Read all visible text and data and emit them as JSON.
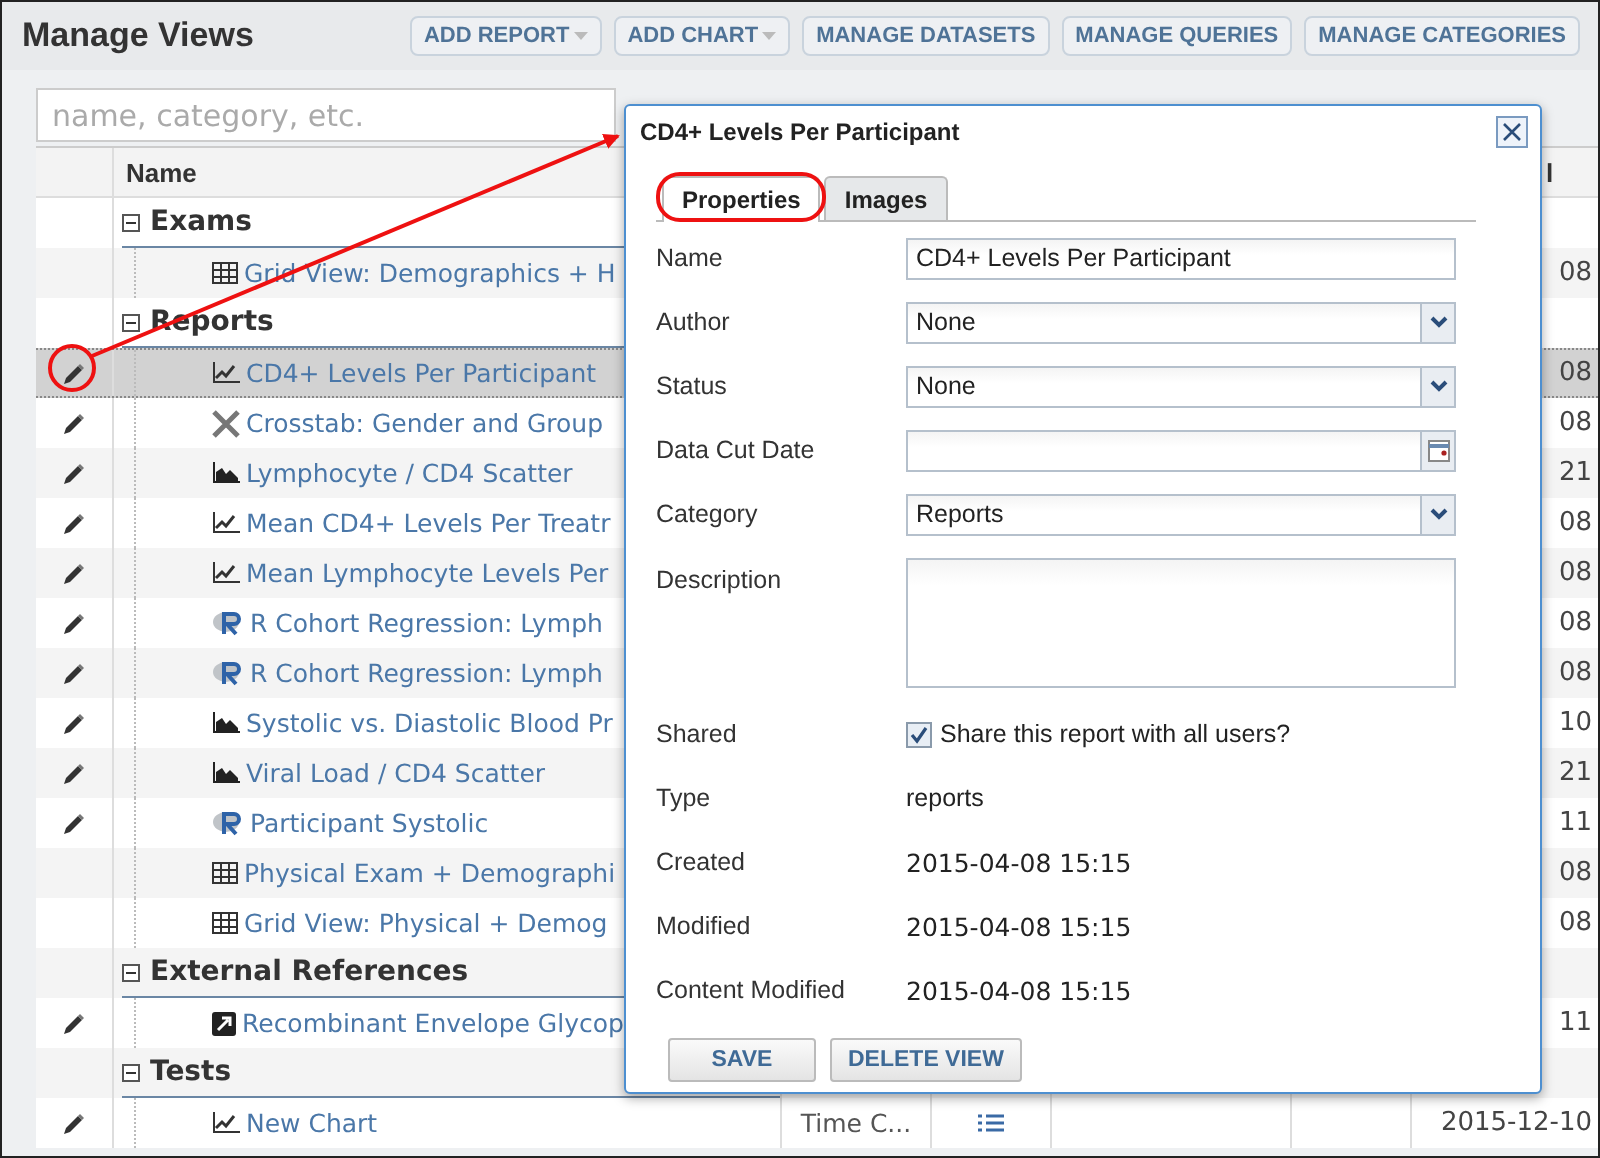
{
  "header": {
    "title": "Manage Views",
    "buttons": [
      {
        "label": "ADD REPORT",
        "dropdown": true
      },
      {
        "label": "ADD CHART",
        "dropdown": true
      },
      {
        "label": "MANAGE DATASETS",
        "dropdown": false
      },
      {
        "label": "MANAGE QUERIES",
        "dropdown": false
      },
      {
        "label": "MANAGE CATEGORIES",
        "dropdown": false
      }
    ]
  },
  "search": {
    "placeholder": "name, category, etc."
  },
  "table": {
    "columns": [
      {
        "label": "Name"
      },
      {
        "label": "l"
      }
    ],
    "groups": [
      {
        "label": "Exams",
        "expanded": true,
        "children": [
          {
            "kind": "grid",
            "name": "Grid View: Demographics + H",
            "editable": false,
            "selected": false,
            "date": "08"
          }
        ]
      },
      {
        "label": "Reports",
        "expanded": true,
        "children": [
          {
            "kind": "line",
            "name": "CD4+ Levels Per Participant",
            "editable": true,
            "selected": true,
            "date": "08"
          },
          {
            "kind": "crosstab",
            "name": "Crosstab: Gender and Group",
            "editable": true,
            "selected": false,
            "date": "08"
          },
          {
            "kind": "scatter",
            "name": "Lymphocyte / CD4 Scatter",
            "editable": true,
            "selected": false,
            "date": "21"
          },
          {
            "kind": "line",
            "name": "Mean CD4+ Levels Per Treatr",
            "editable": true,
            "selected": false,
            "date": "08"
          },
          {
            "kind": "line",
            "name": "Mean Lymphocyte Levels Per",
            "editable": true,
            "selected": false,
            "date": "08"
          },
          {
            "kind": "r",
            "name": "R Cohort Regression: Lymph",
            "editable": true,
            "selected": false,
            "date": "08"
          },
          {
            "kind": "r",
            "name": "R Cohort Regression: Lymph",
            "editable": true,
            "selected": false,
            "date": "08"
          },
          {
            "kind": "scatter",
            "name": "Systolic vs. Diastolic Blood Pr",
            "editable": true,
            "selected": false,
            "date": "10"
          },
          {
            "kind": "scatter",
            "name": "Viral Load / CD4 Scatter",
            "editable": true,
            "selected": false,
            "date": "21"
          },
          {
            "kind": "r",
            "name": "Participant Systolic",
            "editable": true,
            "selected": false,
            "date": "11"
          },
          {
            "kind": "grid",
            "name": "Physical Exam + Demographi",
            "editable": false,
            "selected": false,
            "date": "08"
          },
          {
            "kind": "grid",
            "name": "Grid View: Physical + Demog",
            "editable": false,
            "selected": false,
            "date": "08"
          }
        ]
      },
      {
        "label": "External References",
        "expanded": true,
        "children": [
          {
            "kind": "external",
            "name": "Recombinant Envelope Glycop",
            "editable": true,
            "selected": false,
            "date": "11"
          }
        ]
      },
      {
        "label": "Tests",
        "expanded": true,
        "children": [
          {
            "kind": "line",
            "name": "New Chart",
            "editable": true,
            "selected": false,
            "type": "Time C...",
            "date": "2015-12-10"
          }
        ]
      }
    ]
  },
  "dialog": {
    "title": "CD4+ Levels Per Participant",
    "tabs": [
      {
        "label": "Properties",
        "selected": true
      },
      {
        "label": "Images",
        "selected": false
      }
    ],
    "fields": [
      {
        "kind": "text",
        "label": "Name",
        "value": "CD4+ Levels Per Participant"
      },
      {
        "kind": "select",
        "label": "Author",
        "value": "None"
      },
      {
        "kind": "select",
        "label": "Status",
        "value": "None"
      },
      {
        "kind": "date",
        "label": "Data Cut Date"
      },
      {
        "kind": "select",
        "label": "Category",
        "value": "Reports"
      },
      {
        "kind": "textarea",
        "label": "Description"
      },
      {
        "kind": "checkbox",
        "label": "Shared",
        "value": "Share this report with all users?",
        "checked": true
      },
      {
        "kind": "static",
        "label": "Type",
        "value": "reports"
      },
      {
        "kind": "static",
        "label": "Created",
        "value": "2015-04-08 15:15"
      },
      {
        "kind": "static",
        "label": "Modified",
        "value": "2015-04-08 15:15"
      },
      {
        "kind": "static",
        "label": "Content Modified",
        "value": "2015-04-08 15:15"
      }
    ],
    "buttons": [
      {
        "label": "SAVE"
      },
      {
        "label": "DELETE VIEW"
      }
    ]
  }
}
